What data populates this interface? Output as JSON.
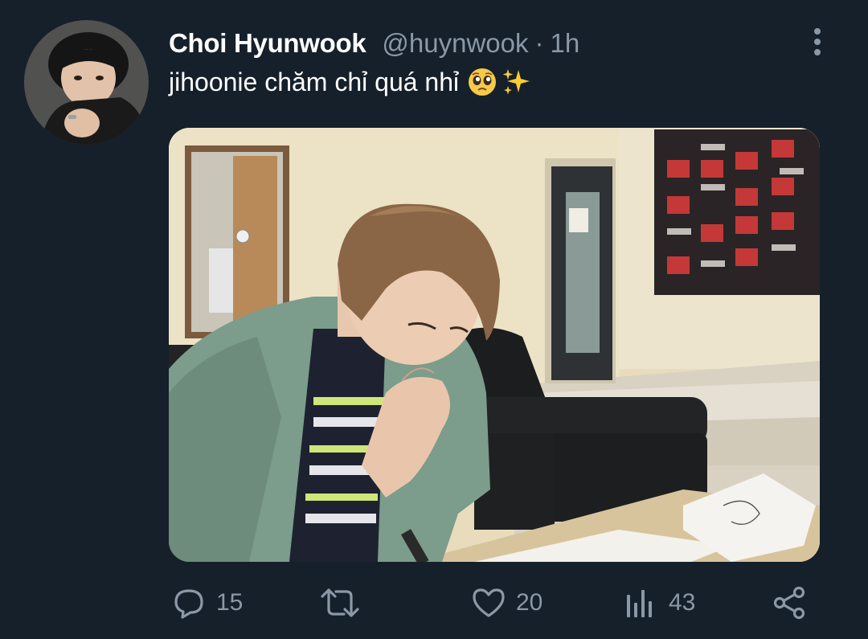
{
  "tweet": {
    "display_name": "Choi Hyunwook",
    "handle": "@huynwook",
    "separator": "·",
    "time": "1h",
    "text": "jihoonie chăm chỉ quá nhỉ",
    "emojis": [
      "pleading-face-emoji",
      "sparkles-emoji"
    ],
    "media_alt_icon": "photo"
  },
  "actions": {
    "reply_count": "15",
    "retweet_count": "",
    "like_count": "20",
    "views_count": "43"
  },
  "colors": {
    "background": "#15202b",
    "secondary_text": "#8b98a5",
    "primary_text": "#ffffff"
  }
}
